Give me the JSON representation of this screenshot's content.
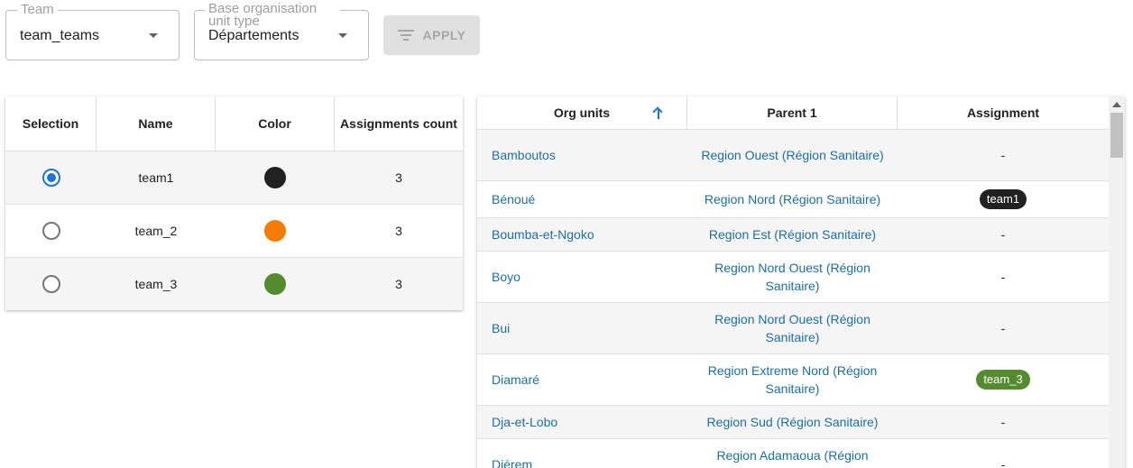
{
  "filters": {
    "team": {
      "label": "Team",
      "value": "team_teams"
    },
    "org_unit_type": {
      "label": "Base organisation unit type",
      "value": "Départements"
    },
    "apply_label": "APPLY"
  },
  "teams_table": {
    "headers": {
      "selection": "Selection",
      "name": "Name",
      "color": "Color",
      "count": "Assignments count"
    },
    "rows": [
      {
        "name": "team1",
        "color": "#212121",
        "count": "3",
        "selected": true
      },
      {
        "name": "team_2",
        "color": "#f57c00",
        "count": "3",
        "selected": false
      },
      {
        "name": "team_3",
        "color": "#558b2f",
        "count": "3",
        "selected": false
      }
    ]
  },
  "org_units_table": {
    "headers": {
      "org_units": "Org units",
      "parent": "Parent 1",
      "assignment": "Assignment"
    },
    "sort": "ascending",
    "rows": [
      {
        "name": "Bamboutos",
        "parent": "Region Ouest (Région Sanitaire)",
        "assignment": "-"
      },
      {
        "name": "Bénoué",
        "parent": "Region Nord (Région Sanitaire)",
        "assignment": "team1",
        "chip_color": "#212121"
      },
      {
        "name": "Boumba-et-Ngoko",
        "parent": "Region Est (Région Sanitaire)",
        "assignment": "-"
      },
      {
        "name": "Boyo",
        "parent": "Region Nord Ouest (Région Sanitaire)",
        "assignment": "-"
      },
      {
        "name": "Bui",
        "parent": "Region Nord Ouest (Région Sanitaire)",
        "assignment": "-"
      },
      {
        "name": "Diamaré",
        "parent": "Region Extreme Nord (Région Sanitaire)",
        "assignment": "team_3",
        "chip_color": "#558b2f"
      },
      {
        "name": "Dja-et-Lobo",
        "parent": "Region Sud (Région Sanitaire)",
        "assignment": "-"
      },
      {
        "name": "Diérem",
        "parent": "Region Adamaoua (Région Sanitaire)",
        "assignment": "-"
      }
    ]
  }
}
